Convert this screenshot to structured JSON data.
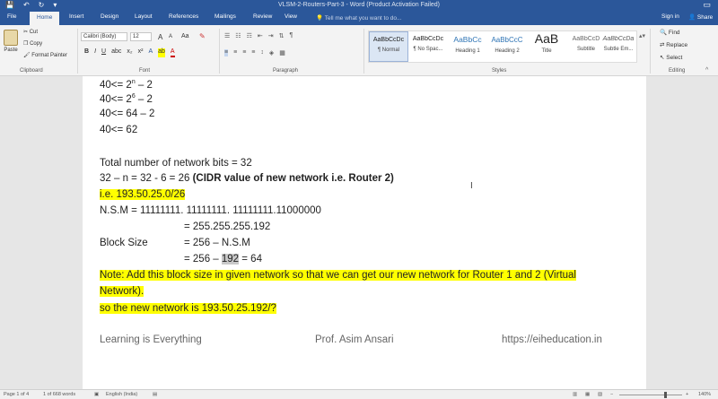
{
  "titlebar": {
    "title": "VLSM-2-Routers-Part-3 - Word (Product Activation Failed)",
    "save_icon": "💾",
    "undo_icon": "↶",
    "redo_icon": "↻",
    "customize_icon": "▾",
    "window_icon": "▭"
  },
  "tabs": {
    "items": [
      "File",
      "Home",
      "Insert",
      "Design",
      "Layout",
      "References",
      "Mailings",
      "Review",
      "View"
    ],
    "tell_me": "Tell me what you want to do...",
    "sign_in": "Sign in",
    "share": "Share"
  },
  "ribbon": {
    "clipboard": {
      "paste": "Paste",
      "cut": "Cut",
      "copy": "Copy",
      "format_painter": "Format Painter",
      "label": "Clipboard"
    },
    "font": {
      "family": "Calibri (Body)",
      "size": "12",
      "grow": "A",
      "shrink": "A",
      "case": "Aa",
      "bold": "B",
      "italic": "I",
      "underline": "U",
      "label": "Font"
    },
    "paragraph": {
      "label": "Paragraph",
      "show_marks": "¶"
    },
    "styles": {
      "label": "Styles",
      "items": [
        {
          "preview": "AaBbCcDc",
          "name": "¶ Normal"
        },
        {
          "preview": "AaBbCcDc",
          "name": "¶ No Spac..."
        },
        {
          "preview": "AaBbCc",
          "name": "Heading 1"
        },
        {
          "preview": "AaBbCcC",
          "name": "Heading 2"
        },
        {
          "preview": "AaB",
          "name": "Title"
        },
        {
          "preview": "AaBbCcD",
          "name": "Subtitle"
        },
        {
          "preview": "AaBbCcDa",
          "name": "Subtle Em..."
        }
      ]
    },
    "editing": {
      "find": "Find",
      "replace": "Replace",
      "select": "Select",
      "label": "Editing"
    }
  },
  "document": {
    "lines": {
      "l1_a": "40<= 2",
      "l1_sup": "n",
      "l1_b": " – 2",
      "l2_a": "40<= 2",
      "l2_sup": "6",
      "l2_b": " – 2",
      "l3": "40<= 64 – 2",
      "l4": "40<= 62",
      "l5": "Total number of network bits = 32",
      "l6_a": "32 – n = 32 - 6 = 26 ",
      "l6_bold": "(CIDR value of new network i.e. Router 2)",
      "l7": "i.e. 193.50.25.0/26",
      "l8": "N.S.M = 11111111. 11111111. 11111111.11000000",
      "l9": "= 255.255.255.192",
      "l10_label": "Block Size",
      "l10_value": "= 256 – N.S.M",
      "l11_a": "= 256 – ",
      "l11_hl": "192",
      "l11_b": " = 64",
      "l12": "Note: Add this block size in given network so that we can get our new network for Router 1 and 2 (Virtual",
      "l13": "Network).",
      "l14": "so the new network is 193.50.25.192/?"
    },
    "footer": {
      "left": "Learning is Everything",
      "center": "Prof. Asim Ansari",
      "right": "https://eiheducation.in"
    }
  },
  "statusbar": {
    "page": "Page 1 of 4",
    "words": "1 of 668 words",
    "language": "English (India)",
    "zoom": "140%"
  }
}
